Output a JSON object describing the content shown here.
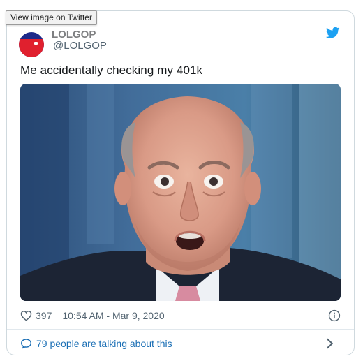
{
  "tooltip": {
    "text": "View image on Twitter"
  },
  "author": {
    "display_name": "LOLGOP",
    "handle": "@LOLGOP"
  },
  "tweet": {
    "text": "Me accidentally checking my 401k"
  },
  "stats": {
    "likes": "397",
    "timestamp": "10:54 AM - Mar 9, 2020"
  },
  "conversation": {
    "label": "79 people are talking about this"
  },
  "icons": {
    "brand": "twitter-bird-icon",
    "like": "heart-icon",
    "info": "info-icon",
    "talk": "speech-bubble-icon",
    "chevron": "chevron-right-icon"
  },
  "colors": {
    "twitter_blue": "#1da1f2",
    "link_blue": "#1b6fb5",
    "muted_text": "#536471",
    "border": "#cfd9de"
  }
}
